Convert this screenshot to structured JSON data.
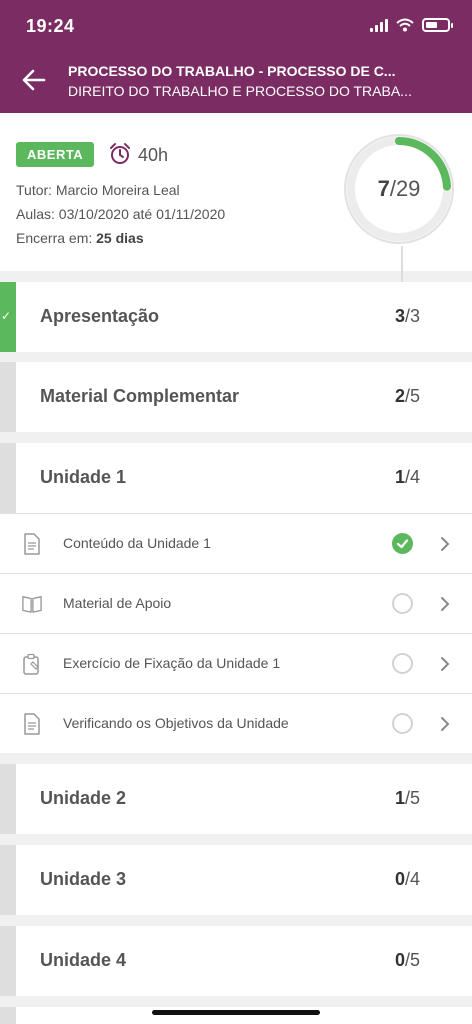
{
  "status_bar": {
    "time": "19:24"
  },
  "header": {
    "title": "PROCESSO DO TRABALHO - PROCESSO DE C...",
    "subtitle": "DIREITO DO TRABALHO E PROCESSO DO TRABA..."
  },
  "course": {
    "status_badge": "ABERTA",
    "hours": "40h",
    "tutor": "Tutor: Marcio Moreira Leal",
    "lessons": "Aulas: 03/10/2020 até 01/11/2020",
    "ends_label": "Encerra em: ",
    "ends_value": "25 dias",
    "progress_done": "7",
    "progress_total": "/29",
    "progress_fraction": 0.2414
  },
  "modules": [
    {
      "label": "Apresentação",
      "done": "3",
      "total": "/3",
      "complete": true
    },
    {
      "label": "Material Complementar",
      "done": "2",
      "total": "/5",
      "complete": false
    },
    {
      "label": "Unidade 1",
      "done": "1",
      "total": "/4",
      "complete": false
    },
    {
      "label": "Unidade 2",
      "done": "1",
      "total": "/5",
      "complete": false
    },
    {
      "label": "Unidade 3",
      "done": "0",
      "total": "/4",
      "complete": false
    },
    {
      "label": "Unidade 4",
      "done": "0",
      "total": "/5",
      "complete": false
    }
  ],
  "unit1_items": [
    {
      "label": "Conteúdo da Unidade 1",
      "icon": "document-icon",
      "completed": true
    },
    {
      "label": "Material de Apoio",
      "icon": "book-icon",
      "completed": false
    },
    {
      "label": "Exercício de Fixação da Unidade 1",
      "icon": "clipboard-icon",
      "completed": false
    },
    {
      "label": "Verificando os Objetivos da Unidade",
      "icon": "document-icon",
      "completed": false
    }
  ],
  "colors": {
    "header": "#7b2d63",
    "accent_green": "#5cb85c"
  }
}
